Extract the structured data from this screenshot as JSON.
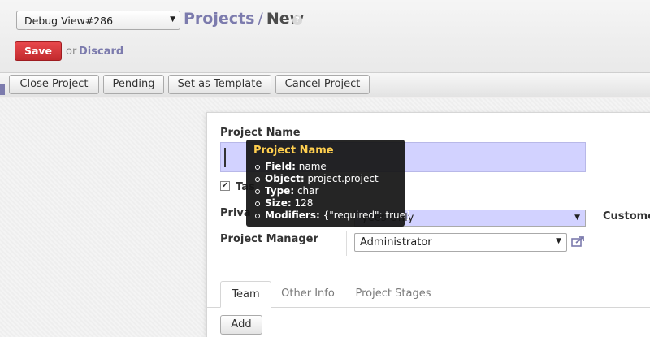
{
  "header": {
    "debug_select": "Debug View#286",
    "breadcrumb_parent": "Projects",
    "breadcrumb_separator": "/",
    "breadcrumb_current": "New",
    "help_icon": "?"
  },
  "form_buttons": {
    "save_label": "Save",
    "or_text": "or",
    "discard_label": "Discard"
  },
  "actions": [
    "Close Project",
    "Pending",
    "Set as Template",
    "Cancel Project"
  ],
  "form": {
    "name_label": "Project Name",
    "name_value": "",
    "tasks_label": "Tas",
    "tasks_checked": true,
    "privacy_label": "Priva",
    "privacy_value": "yees Only",
    "customer_label": "Custome",
    "manager_label": "Project Manager",
    "manager_value": "Administrator"
  },
  "tabs": [
    "Team",
    "Other Info",
    "Project Stages"
  ],
  "active_tab": "Team",
  "add_label": "Add",
  "tooltip": {
    "title": "Project Name",
    "items": [
      {
        "key": "Field:",
        "value": "name"
      },
      {
        "key": "Object:",
        "value": "project.project"
      },
      {
        "key": "Type:",
        "value": "char"
      },
      {
        "key": "Size:",
        "value": "128"
      },
      {
        "key": "Modifiers:",
        "value": "{\"required\": true}"
      }
    ]
  },
  "colors": {
    "accent": "#7c7bad",
    "save": "#d0393d",
    "required_field": "#d2d2ff",
    "tooltip_title": "#ffcf4f"
  }
}
